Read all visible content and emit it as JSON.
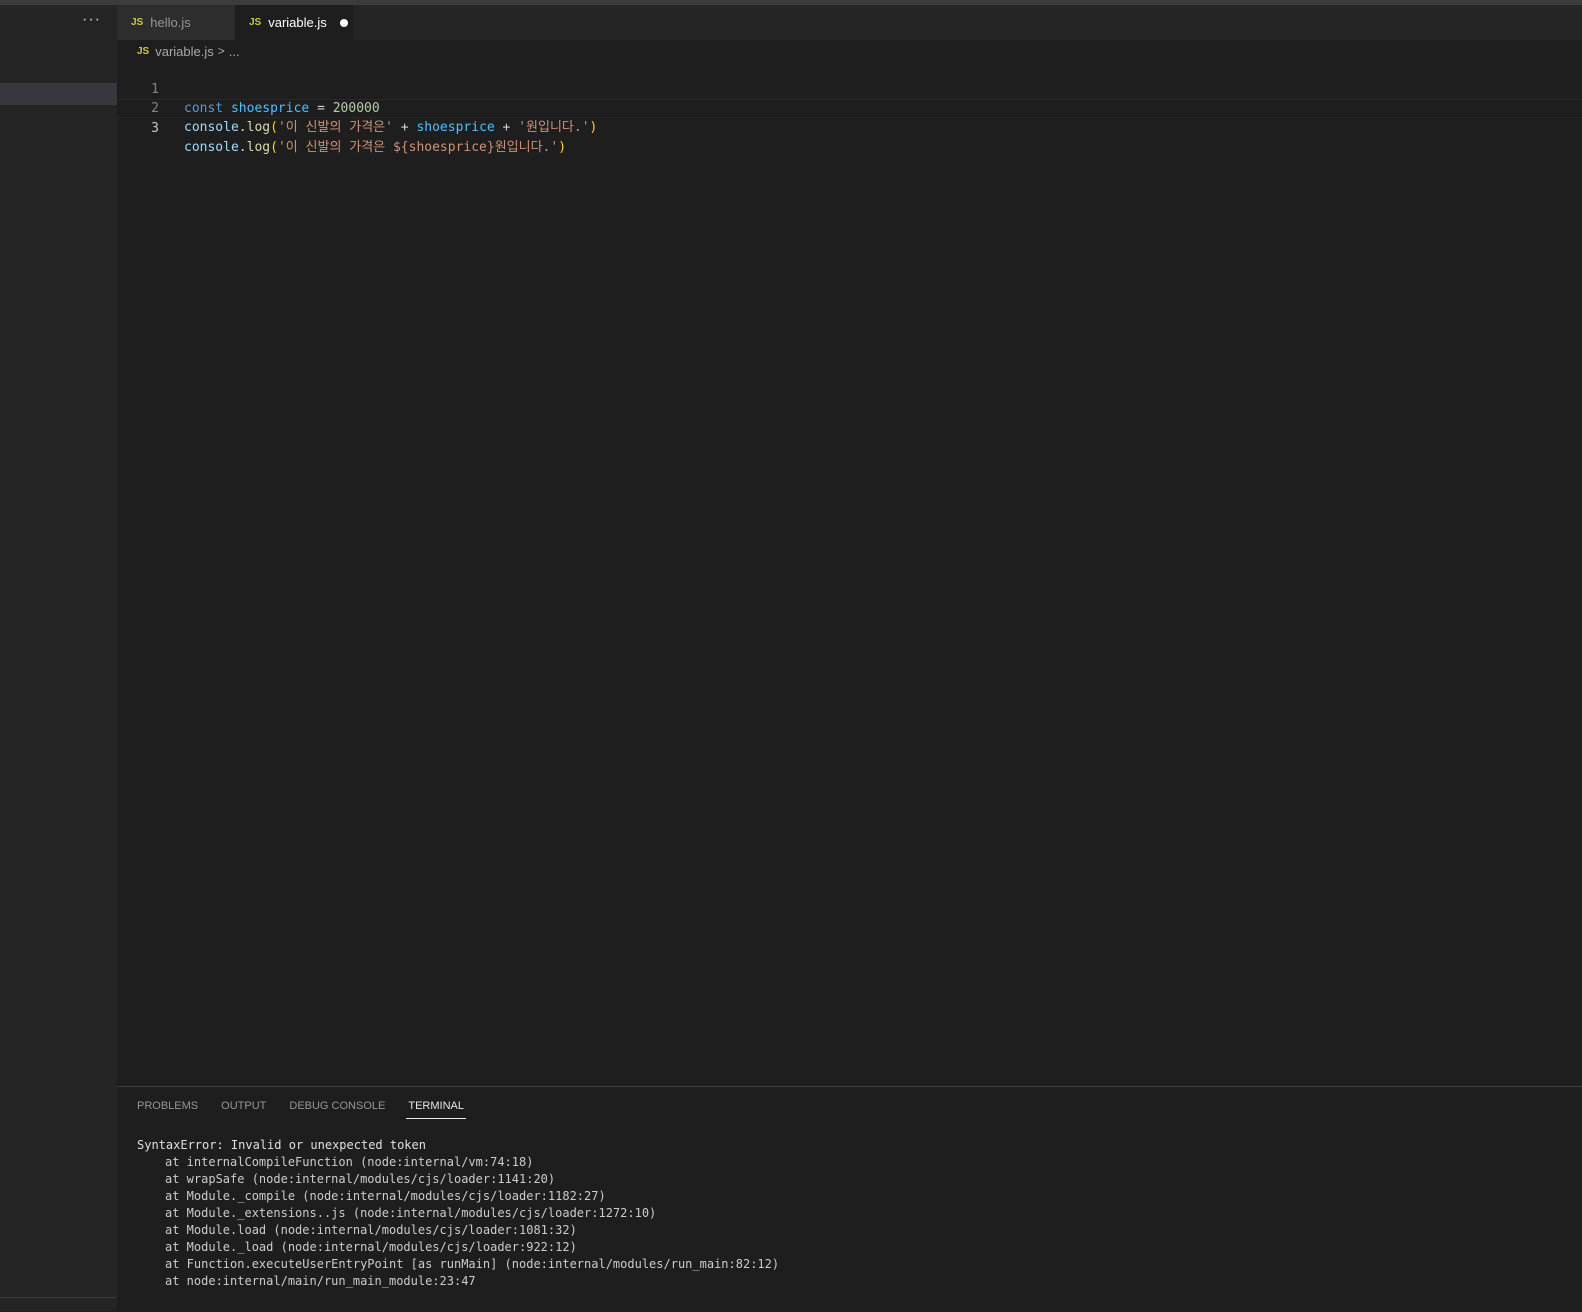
{
  "sidebar": {
    "more_label": "···"
  },
  "tabs": [
    {
      "icon": "JS",
      "label": "hello.js",
      "active": false
    },
    {
      "icon": "JS",
      "label": "variable.js",
      "active": true,
      "dirty": true
    }
  ],
  "breadcrumb": {
    "icon": "JS",
    "file": "variable.js",
    "separator": ">",
    "rest": "..."
  },
  "editor": {
    "lines": [
      {
        "number": "1",
        "tokens": [
          "const",
          " ",
          "shoesprice",
          " = ",
          "200000"
        ]
      },
      {
        "number": "2",
        "tokens": [
          "console",
          ".",
          "log",
          "(",
          "'이 신발의 가격은'",
          " + ",
          "shoesprice",
          " + ",
          "'원입니다.'",
          ")"
        ]
      },
      {
        "number": "3",
        "tokens": [
          "console",
          ".",
          "log",
          "(",
          "'이 신발의 가격은 ${shoesprice}원입니다.'",
          ")"
        ]
      }
    ]
  },
  "panel": {
    "tabs": [
      "PROBLEMS",
      "OUTPUT",
      "DEBUG CONSOLE",
      "TERMINAL"
    ],
    "active_tab": "TERMINAL",
    "terminal": {
      "error": "SyntaxError: Invalid or unexpected token",
      "trace": [
        "at internalCompileFunction (node:internal/vm:74:18)",
        "at wrapSafe (node:internal/modules/cjs/loader:1141:20)",
        "at Module._compile (node:internal/modules/cjs/loader:1182:27)",
        "at Module._extensions..js (node:internal/modules/cjs/loader:1272:10)",
        "at Module.load (node:internal/modules/cjs/loader:1081:32)",
        "at Module._load (node:internal/modules/cjs/loader:922:12)",
        "at Function.executeUserEntryPoint [as runMain] (node:internal/modules/run_main:82:12)",
        "at node:internal/main/run_main_module:23:47"
      ]
    }
  },
  "colors": {
    "background": "#1e1e1e",
    "sidebar": "#252526",
    "js_icon": "#cbcb41",
    "keyword": "#569cd6",
    "string": "#ce9178",
    "number": "#b5cea8"
  }
}
